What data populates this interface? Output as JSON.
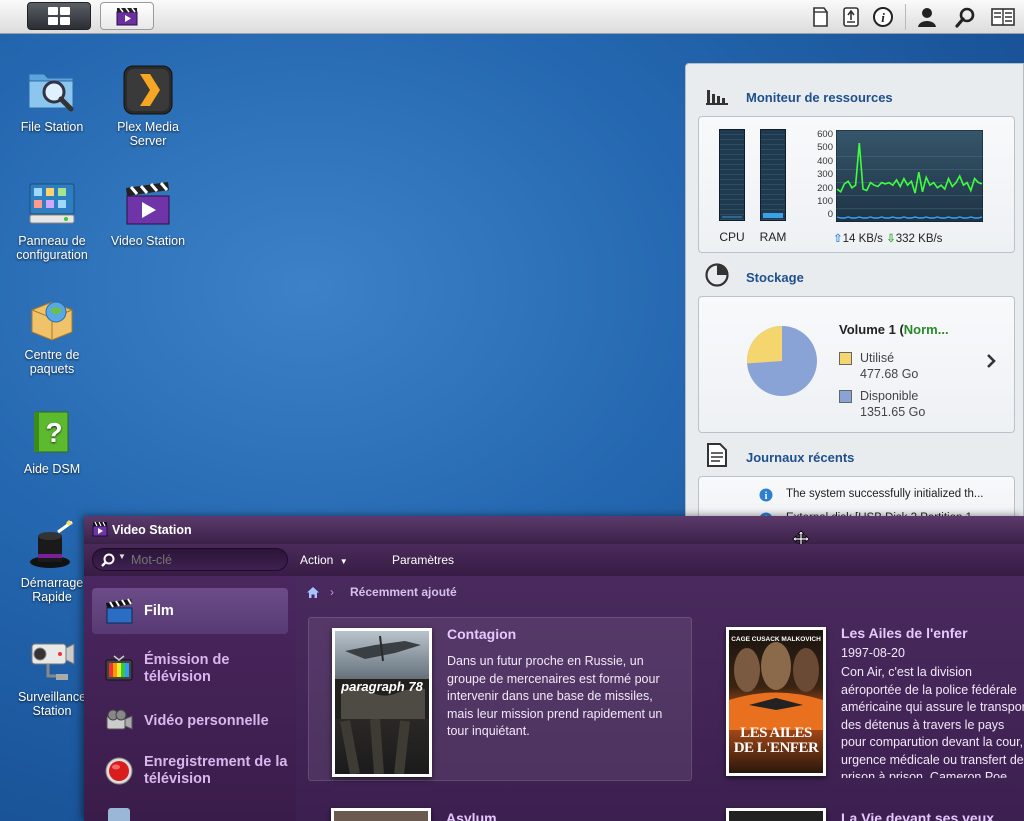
{
  "desktop": {
    "icons": [
      {
        "label": "File Station",
        "icon": "file-station-icon"
      },
      {
        "label": "Plex Media Server",
        "icon": "plex-icon"
      },
      {
        "label": "Panneau de configuration",
        "icon": "control-panel-icon"
      },
      {
        "label": "Video Station",
        "icon": "video-station-icon"
      },
      {
        "label": "Centre de paquets",
        "icon": "package-center-icon"
      },
      {
        "label": "Aide DSM",
        "icon": "help-icon"
      },
      {
        "label": "Démarrage Rapide",
        "icon": "magic-hat-icon"
      },
      {
        "label": "Surveillance Station",
        "icon": "camera-icon"
      }
    ]
  },
  "widgets": {
    "resource_monitor": {
      "title": "Moniteur de ressources",
      "cpu_label": "CPU",
      "ram_label": "RAM",
      "cpu_level": 0.02,
      "ram_level": 0.06,
      "y_ticks": [
        "600",
        "500",
        "400",
        "300",
        "200",
        "100",
        "0"
      ],
      "upload": "14 KB/s",
      "download": "332 KB/s",
      "graph_values": [
        250,
        230,
        290,
        310,
        260,
        280,
        600,
        250,
        240,
        300,
        280,
        270,
        300,
        290,
        300,
        280,
        320,
        270,
        330,
        280,
        310,
        220,
        380,
        230,
        340,
        280,
        300,
        260,
        280,
        250,
        330,
        270,
        300,
        350,
        280,
        300,
        240,
        330,
        300,
        290
      ]
    },
    "storage": {
      "title": "Stockage",
      "volume": "Volume 1 (",
      "volume_status": "Norm...",
      "used_label": "Utilisé",
      "used_value": "477.68 Go",
      "free_label": "Disponible",
      "free_value": "1351.65 Go",
      "used_color": "#f5d66e",
      "free_color": "#8aa3d6",
      "used_fraction": 0.261
    },
    "logs": {
      "title": "Journaux récents",
      "entries": [
        "The system successfully initialized th...",
        "External disk [USB Disk 2 Partition 1..."
      ]
    }
  },
  "video_station": {
    "title": "Video Station",
    "search_placeholder": "Mot-clé",
    "action_label": "Action",
    "settings_label": "Paramètres",
    "breadcrumb": "Récemment ajouté",
    "sidebar": [
      {
        "label": "Film"
      },
      {
        "label": "Émission de télévision"
      },
      {
        "label": "Vidéo personnelle"
      },
      {
        "label": "Enregistrement de la télévision"
      }
    ],
    "movies": [
      {
        "title": "Contagion",
        "date": "",
        "description": "Dans un futur proche en Russie, un groupe de mercenaires est formé pour intervenir dans une base de missiles, mais leur mission prend rapidement un tour inquiétant.",
        "poster_text": "paragraph 78"
      },
      {
        "title": "Les Ailes de l'enfer",
        "date": "1997-08-20",
        "description": "Con Air, c'est la division aéroportée de la police fédérale américaine qui assure le transport des détenus à travers le pays pour comparution devant la cour, urgence médicale ou transfert de prison à prison. Cameron Poe, récemment libéré sur parole...",
        "poster_text": "LES AILES DE L'ENFER",
        "poster_actors": "CAGE   CUSACK   MALKOVICH"
      },
      {
        "title": "Asylum"
      },
      {
        "title": "La Vie devant ses yeux"
      }
    ]
  }
}
